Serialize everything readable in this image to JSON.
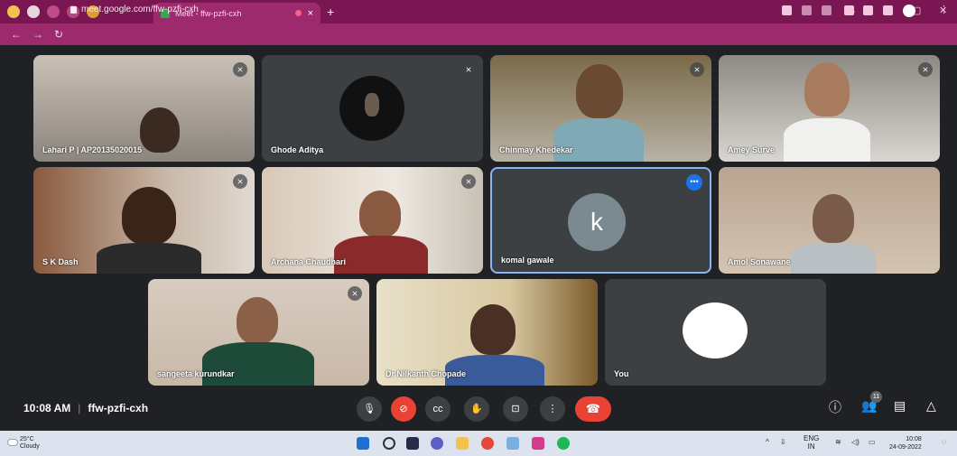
{
  "browser": {
    "tab_title": "Meet - ffw-pzfi-cxh",
    "tab_close": "×",
    "new_tab": "+",
    "url": "meet.google.com/ffw-pzfi-cxh"
  },
  "participants": [
    {
      "name": "Lahari P | AP20135020015"
    },
    {
      "name": "Ghode Aditya"
    },
    {
      "name": "Chinmay Khedekar"
    },
    {
      "name": "Amey Surve"
    },
    {
      "name": "S K Dash"
    },
    {
      "name": "Archana Chaudhari"
    },
    {
      "name": "komal gawale",
      "initial": "k"
    },
    {
      "name": "Amol Sonawane"
    },
    {
      "name": "sangeeta kurundkar"
    },
    {
      "name": "Dr Nilkanth Chopade"
    },
    {
      "name": "You"
    }
  ],
  "meeting": {
    "time": "10:08 AM",
    "separator": "|",
    "code": "ffw-pzfi-cxh",
    "participant_count": "11"
  },
  "taskbar": {
    "temperature": "25°C",
    "weather": "Cloudy",
    "lang": "ENG",
    "lang_region": "IN",
    "time": "10:08",
    "date": "24-09-2022"
  },
  "colors": {
    "tabbar": "#7a1752",
    "addressbar": "#9c2a6c",
    "meet_bg": "#202124",
    "hangup": "#ea4335",
    "active_speaker_border": "#8ab4f8"
  }
}
